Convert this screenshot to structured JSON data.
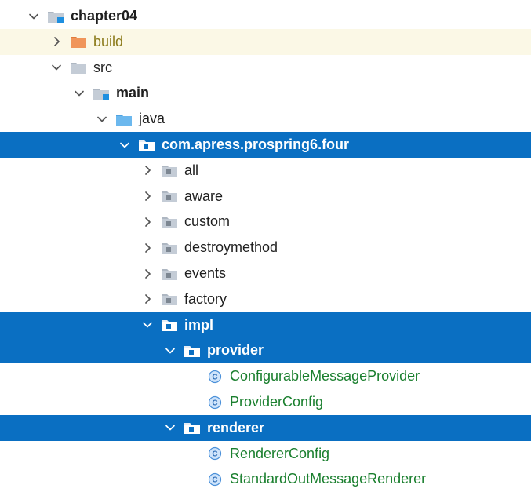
{
  "project_tree": {
    "rows": [
      {
        "label": "chapter04",
        "icon": "module-folder-icon",
        "toggle": "expanded",
        "depth": 0,
        "style": "bold"
      },
      {
        "label": "build",
        "icon": "excluded-folder-icon",
        "toggle": "collapsed",
        "depth": 1,
        "style": "excluded"
      },
      {
        "label": "src",
        "icon": "folder-icon",
        "toggle": "expanded",
        "depth": 1,
        "style": "normal"
      },
      {
        "label": "main",
        "icon": "source-root-folder-icon",
        "toggle": "expanded",
        "depth": 2,
        "style": "bold"
      },
      {
        "label": "java",
        "icon": "java-source-folder-icon",
        "toggle": "expanded",
        "depth": 3,
        "style": "normal"
      },
      {
        "label": "com.apress.prospring6.four",
        "icon": "package-icon",
        "toggle": "expanded",
        "depth": 4,
        "style": "selected"
      },
      {
        "label": "all",
        "icon": "package-icon",
        "toggle": "collapsed",
        "depth": 5,
        "style": "normal"
      },
      {
        "label": "aware",
        "icon": "package-icon",
        "toggle": "collapsed",
        "depth": 5,
        "style": "normal"
      },
      {
        "label": "custom",
        "icon": "package-icon",
        "toggle": "collapsed",
        "depth": 5,
        "style": "normal"
      },
      {
        "label": "destroymethod",
        "icon": "package-icon",
        "toggle": "collapsed",
        "depth": 5,
        "style": "normal"
      },
      {
        "label": "events",
        "icon": "package-icon",
        "toggle": "collapsed",
        "depth": 5,
        "style": "normal"
      },
      {
        "label": "factory",
        "icon": "package-icon",
        "toggle": "collapsed",
        "depth": 5,
        "style": "normal"
      },
      {
        "label": "impl",
        "icon": "package-icon",
        "toggle": "expanded",
        "depth": 5,
        "style": "selected"
      },
      {
        "label": "provider",
        "icon": "package-icon",
        "toggle": "expanded",
        "depth": 6,
        "style": "selected"
      },
      {
        "label": "ConfigurableMessageProvider",
        "icon": "java-class-icon",
        "toggle": "none",
        "depth": 7,
        "style": "green"
      },
      {
        "label": "ProviderConfig",
        "icon": "java-class-icon",
        "toggle": "none",
        "depth": 7,
        "style": "green"
      },
      {
        "label": "renderer",
        "icon": "package-icon",
        "toggle": "expanded",
        "depth": 6,
        "style": "selected"
      },
      {
        "label": "RendererConfig",
        "icon": "java-class-icon",
        "toggle": "none",
        "depth": 7,
        "style": "green"
      },
      {
        "label": "StandardOutMessageRenderer",
        "icon": "java-class-icon",
        "toggle": "none",
        "depth": 7,
        "style": "green"
      }
    ]
  },
  "colors": {
    "selection": "#0a6fc2",
    "excluded_bg": "#fbf8e6",
    "class_text": "#1a7f2e",
    "excluded_text": "#8b7a1a"
  }
}
